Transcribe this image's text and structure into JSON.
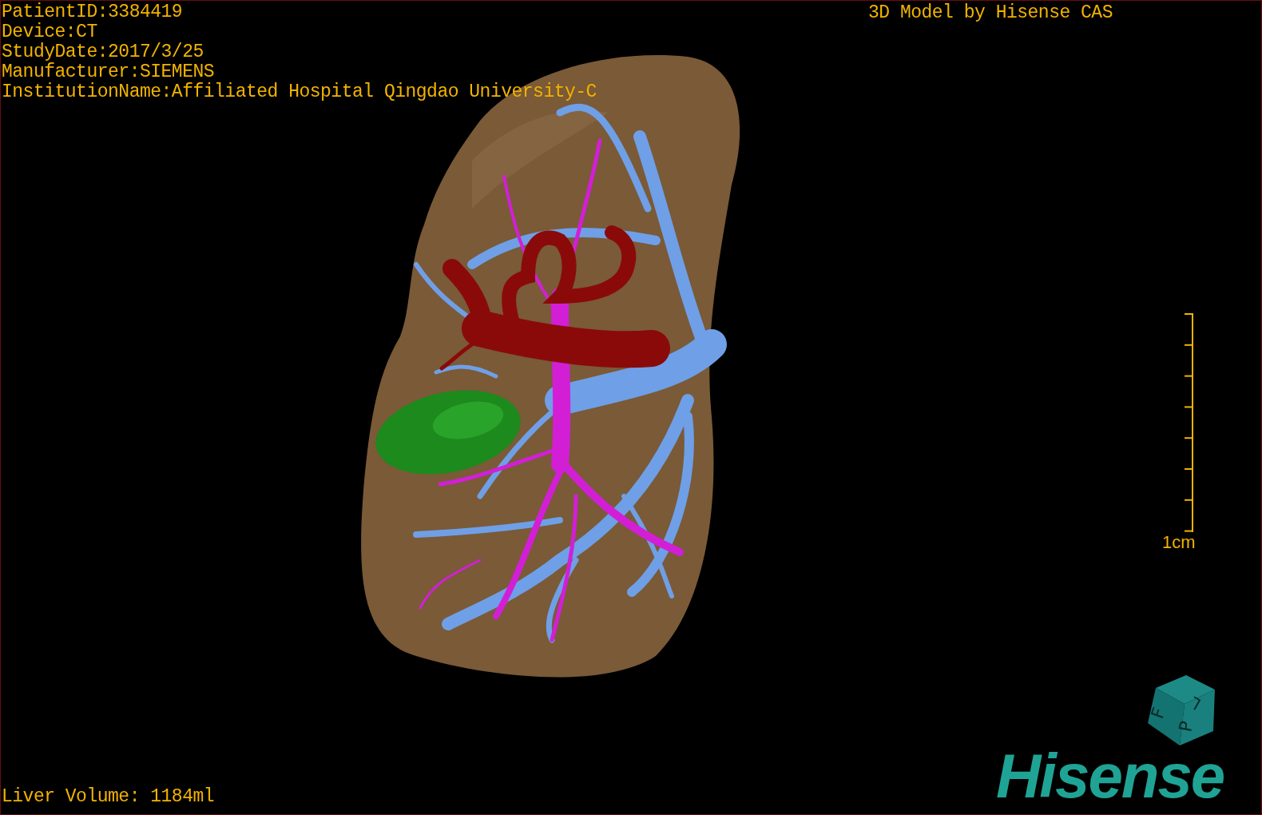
{
  "study_info": [
    "PatientID:3384419",
    "Device:CT",
    "StudyDate:2017/3/25",
    "Manufacturer:SIEMENS",
    "InstitutionName:Affiliated Hospital Qingdao University-C"
  ],
  "credit": "3D Model by Hisense CAS",
  "scale": {
    "label": "1cm"
  },
  "orientation_cube": {
    "faces": [
      "F",
      "L",
      "P"
    ]
  },
  "liver_volume": "Liver Volume: 1184ml",
  "brand": "Hisense"
}
